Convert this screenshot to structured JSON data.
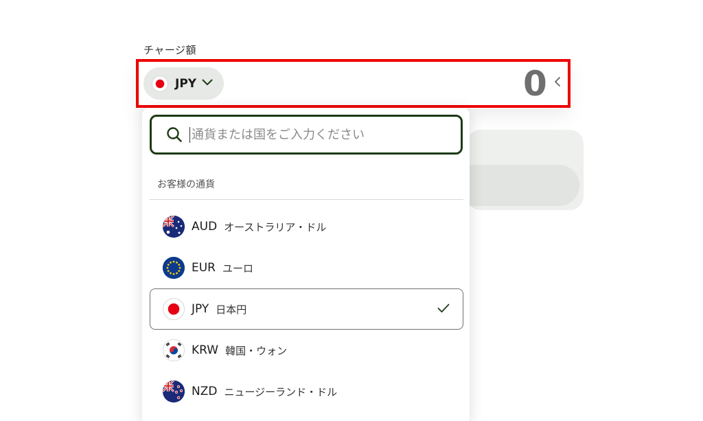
{
  "amount": {
    "label": "チャージ額",
    "currency_code": "JPY",
    "value": "0"
  },
  "dropdown": {
    "search": {
      "placeholder": "通貨または国をご入力ください"
    },
    "section_title": "お客様の通貨",
    "items": [
      {
        "code": "AUD",
        "name": "オーストラリア・ドル",
        "flag": "australia-flag",
        "selected": false
      },
      {
        "code": "EUR",
        "name": "ユーロ",
        "flag": "eu-flag",
        "selected": false
      },
      {
        "code": "JPY",
        "name": "日本円",
        "flag": "japan-flag",
        "selected": true
      },
      {
        "code": "KRW",
        "name": "韓国・ウォン",
        "flag": "korea-flag",
        "selected": false
      },
      {
        "code": "NZD",
        "name": "ニュージーランド・ドル",
        "flag": "new-zealand-flag",
        "selected": false
      }
    ]
  },
  "colors": {
    "highlight": "#ee0000",
    "search_border": "#1d3a13",
    "pill_bg": "#e7e9e6",
    "amount_text": "#6f6f6f"
  }
}
